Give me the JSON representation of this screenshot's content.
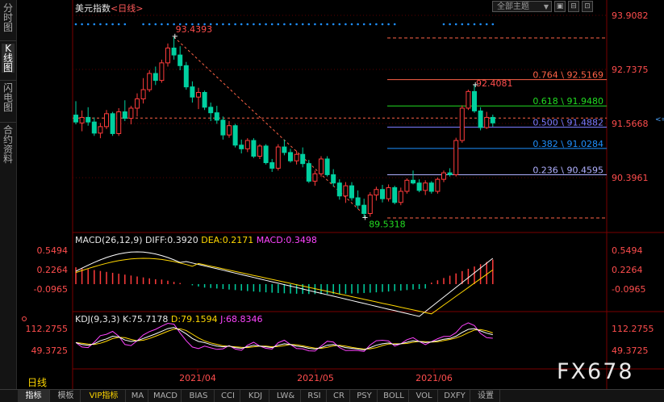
{
  "sidebar": {
    "items": [
      "分时图",
      "K线图",
      "闪电图",
      "合约资料"
    ],
    "active_index": 1
  },
  "header": {
    "title": "美元指数",
    "period": "<日线>",
    "theme": "全部主题",
    "theme_arrow": "▼",
    "btn1": "▣",
    "btn2": "⊟",
    "btn3": "⊡"
  },
  "price_axis": [
    "93.9082",
    "92.7375",
    "91.5668",
    "90.3961"
  ],
  "current_price_marker": "<=>",
  "annotations": {
    "high": "93.4393",
    "low": "89.5318",
    "recent_high": "92.4081"
  },
  "fibonacci": [
    {
      "label": "0.764 \\ 92.5169",
      "value": 92.5169,
      "color": "#ff6347"
    },
    {
      "label": "0.618 \\ 91.9480",
      "value": 91.948,
      "color": "#22dd22"
    },
    {
      "label": "0.500 \\ 91.4882",
      "value": 91.4882,
      "color": "#7b7bff"
    },
    {
      "label": "0.382 \\ 91.0284",
      "value": 91.0284,
      "color": "#1e90ff"
    },
    {
      "label": "0.236 \\ 90.4595",
      "value": 90.4595,
      "color": "#b0b0ff"
    }
  ],
  "fib_bounds": {
    "top": 93.4393,
    "bottom": 89.5318
  },
  "macd": {
    "title": "MACD(26,12,9)",
    "diff": "DIFF:0.3920",
    "dea": "DEA:0.2171",
    "macd": "MACD:0.3498",
    "axis": [
      "0.5494",
      "0.2264",
      "-0.0965"
    ]
  },
  "kdj": {
    "title": "KDJ(9,3,3)",
    "k": "K:75.7178",
    "d": "D:79.1594",
    "j": "J:68.8346",
    "axis": [
      "112.2755",
      "49.3725"
    ]
  },
  "x_axis": [
    "2021/04",
    "2021/05",
    "2021/06"
  ],
  "period_label": "日线",
  "watermark": "FX678",
  "tabs": [
    "指标",
    "模板",
    "VIP指标",
    "MA",
    "MACD",
    "BIAS",
    "CCI",
    "KDJ",
    "LW&",
    "RSI",
    "CR",
    "PSY",
    "BOLL",
    "VOL",
    "DXFY",
    "设置"
  ],
  "active_tab": 0,
  "colors": {
    "up": "#ff3b3b",
    "down": "#00d0a0",
    "bg": "#000000",
    "grid": "#3a0000"
  },
  "chart_data": {
    "type": "candlestick",
    "ohlc": [
      [
        91.75,
        92.05,
        91.55,
        91.6
      ],
      [
        91.58,
        91.85,
        91.4,
        91.7
      ],
      [
        91.7,
        91.92,
        91.52,
        91.6
      ],
      [
        91.6,
        91.7,
        91.3,
        91.36
      ],
      [
        91.36,
        91.58,
        91.25,
        91.5
      ],
      [
        91.5,
        91.86,
        91.45,
        91.78
      ],
      [
        91.78,
        91.82,
        91.3,
        91.35
      ],
      [
        91.35,
        91.9,
        91.3,
        91.82
      ],
      [
        91.82,
        92.07,
        91.62,
        91.68
      ],
      [
        91.68,
        91.95,
        91.55,
        91.9
      ],
      [
        91.9,
        92.22,
        91.72,
        92.1
      ],
      [
        92.1,
        92.55,
        92.0,
        92.3
      ],
      [
        92.3,
        92.72,
        92.25,
        92.65
      ],
      [
        92.65,
        92.8,
        92.4,
        92.5
      ],
      [
        92.5,
        92.95,
        92.45,
        92.88
      ],
      [
        92.88,
        93.3,
        92.8,
        93.2
      ],
      [
        93.2,
        93.44,
        92.95,
        93.05
      ],
      [
        93.05,
        93.24,
        92.72,
        92.82
      ],
      [
        92.82,
        92.9,
        92.3,
        92.36
      ],
      [
        92.36,
        92.48,
        92.02,
        92.14
      ],
      [
        92.14,
        92.34,
        91.88,
        92.24
      ],
      [
        92.24,
        92.28,
        91.86,
        91.92
      ],
      [
        91.92,
        92.02,
        91.62,
        91.8
      ],
      [
        91.8,
        91.95,
        91.56,
        91.64
      ],
      [
        91.64,
        91.72,
        91.22,
        91.32
      ],
      [
        91.32,
        91.62,
        91.26,
        91.52
      ],
      [
        91.52,
        91.56,
        91.05,
        91.1
      ],
      [
        91.1,
        91.22,
        90.92,
        91.02
      ],
      [
        91.02,
        91.25,
        90.95,
        91.2
      ],
      [
        91.2,
        91.25,
        90.82,
        90.86
      ],
      [
        90.86,
        91.12,
        90.8,
        91.08
      ],
      [
        91.08,
        91.12,
        90.68,
        90.72
      ],
      [
        90.72,
        90.8,
        90.52,
        90.6
      ],
      [
        90.6,
        91.12,
        90.55,
        91.06
      ],
      [
        91.06,
        91.22,
        90.88,
        90.94
      ],
      [
        90.94,
        91.02,
        90.72,
        90.76
      ],
      [
        90.76,
        90.98,
        90.68,
        90.9
      ],
      [
        90.9,
        91.05,
        90.62,
        90.7
      ],
      [
        90.7,
        90.78,
        90.28,
        90.32
      ],
      [
        90.32,
        90.55,
        90.22,
        90.48
      ],
      [
        90.48,
        90.86,
        90.42,
        90.8
      ],
      [
        90.8,
        90.86,
        90.42,
        90.46
      ],
      [
        90.46,
        90.58,
        90.2,
        90.28
      ],
      [
        90.28,
        90.36,
        89.92,
        90.0
      ],
      [
        90.0,
        90.3,
        89.85,
        90.22
      ],
      [
        90.22,
        90.3,
        89.9,
        89.96
      ],
      [
        89.96,
        90.12,
        89.72,
        89.8
      ],
      [
        89.8,
        89.94,
        89.53,
        89.62
      ],
      [
        89.62,
        90.08,
        89.55,
        90.02
      ],
      [
        90.02,
        90.2,
        89.9,
        90.14
      ],
      [
        90.14,
        90.24,
        89.86,
        89.94
      ],
      [
        89.94,
        90.25,
        89.88,
        90.18
      ],
      [
        90.18,
        90.22,
        89.82,
        89.86
      ],
      [
        89.86,
        90.18,
        89.8,
        90.1
      ],
      [
        90.1,
        90.38,
        90.05,
        90.34
      ],
      [
        90.34,
        90.55,
        90.25,
        90.28
      ],
      [
        90.28,
        90.36,
        90.08,
        90.12
      ],
      [
        90.12,
        90.34,
        90.02,
        90.28
      ],
      [
        90.28,
        90.32,
        90.05,
        90.1
      ],
      [
        90.1,
        90.4,
        90.05,
        90.36
      ],
      [
        90.36,
        90.55,
        90.3,
        90.5
      ],
      [
        90.5,
        90.6,
        90.42,
        90.46
      ],
      [
        90.46,
        91.26,
        90.42,
        91.2
      ],
      [
        91.2,
        91.96,
        91.15,
        91.9
      ],
      [
        91.9,
        92.3,
        91.86,
        92.26
      ],
      [
        92.26,
        92.41,
        91.8,
        91.84
      ],
      [
        91.84,
        91.92,
        91.42,
        91.48
      ],
      [
        91.48,
        91.82,
        91.45,
        91.7
      ],
      [
        91.7,
        91.76,
        91.5,
        91.58
      ]
    ]
  }
}
